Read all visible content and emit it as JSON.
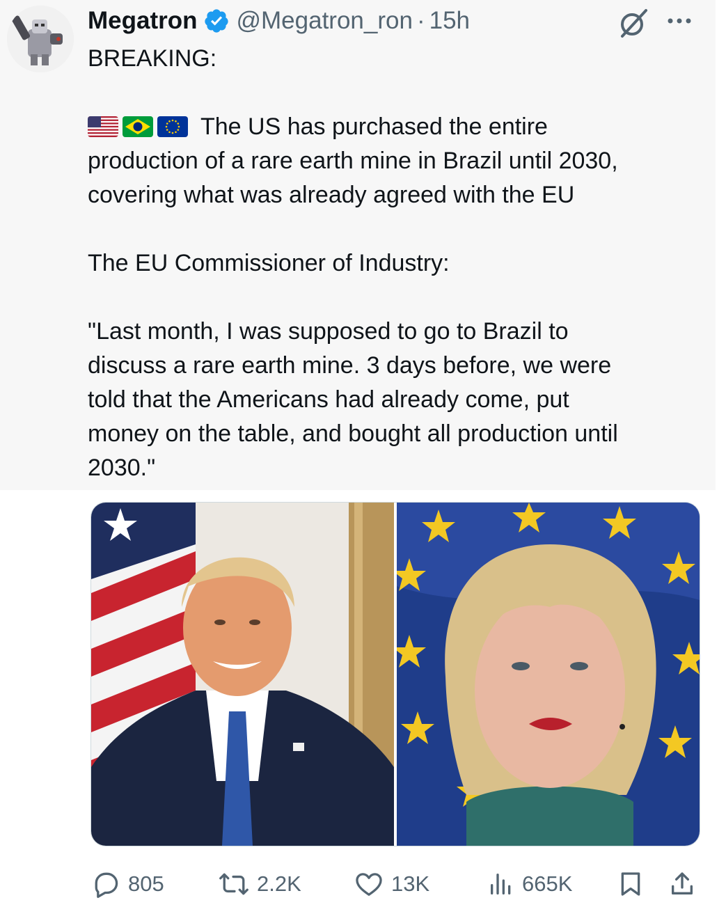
{
  "tweet": {
    "author": {
      "display_name": "Megatron",
      "handle": "@Megatron_ron",
      "verified": true,
      "avatar_icon": "robot-avatar-icon"
    },
    "separator": "·",
    "timestamp": "15h",
    "body": {
      "line1": "BREAKING:",
      "flag_icons": [
        "us-flag-icon",
        "brazil-flag-icon",
        "eu-flag-icon"
      ],
      "line2": "The US has purchased the entire",
      "line3": "production of a rare earth mine in Brazil until 2030,",
      "line4": "covering what was already agreed with the EU",
      "line5": "The EU Commissioner of Industry:",
      "line6": "\"Last month, I was supposed to go to Brazil to",
      "line7": "discuss a rare earth mine. 3 days before, we were",
      "line8": "told that the Americans had already come, put",
      "line9": "money on the table, and bought all production until",
      "line10": "2030.\""
    },
    "media": {
      "left_photo": "man-in-suit-with-us-flag-photo",
      "right_photo": "woman-with-eu-flag-photo"
    },
    "actions": {
      "replies": "805",
      "reposts": "2.2K",
      "likes": "13K",
      "views": "665K"
    }
  },
  "colors": {
    "accent": "#1d9bf0",
    "text_primary": "#0f1419",
    "text_secondary": "#536471",
    "panel_background": "#f7f7f7"
  }
}
